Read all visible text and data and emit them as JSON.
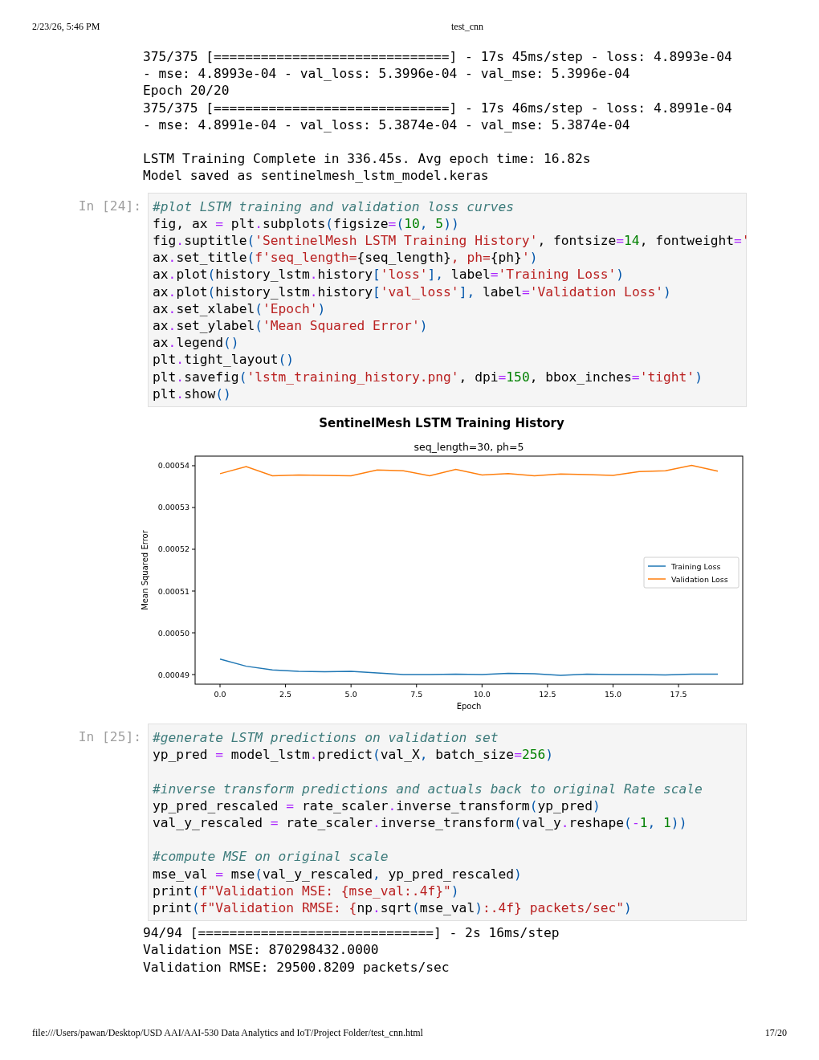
{
  "header": {
    "datetime": "2/23/26, 5:46 PM",
    "title": "test_cnn"
  },
  "cells": [
    {
      "kind": "output",
      "blocks": [
        [
          "375/375 [==============================] - 17s 45ms/step - loss: 4.8993e-04",
          "- mse: 4.8993e-04 - val_loss: 5.3996e-04 - val_mse: 5.3996e-04",
          "Epoch 20/20",
          "375/375 [==============================] - 17s 46ms/step - loss: 4.8991e-04",
          "- mse: 4.8991e-04 - val_loss: 5.3874e-04 - val_mse: 5.3874e-04"
        ],
        [
          "LSTM Training Complete in 336.45s. Avg epoch time: 16.82s",
          "Model saved as sentinelmesh_lstm_model.keras"
        ]
      ]
    },
    {
      "kind": "code",
      "prompt": "In [24]:",
      "blocks": [
        [
          [
            {
              "kind": "comment",
              "text": "#plot LSTM training and validation loss curves"
            }
          ],
          [
            {
              "kind": "text",
              "text": "fig, ax "
            },
            {
              "kind": "operator",
              "text": "="
            },
            {
              "kind": "text",
              "text": " plt"
            },
            {
              "kind": "operator",
              "text": "."
            },
            {
              "kind": "text",
              "text": "subplots"
            },
            {
              "kind": "punct",
              "text": "("
            },
            {
              "kind": "text",
              "text": "figsize"
            },
            {
              "kind": "operator",
              "text": "="
            },
            {
              "kind": "punct",
              "text": "("
            },
            {
              "kind": "number",
              "text": "10"
            },
            {
              "kind": "punct",
              "text": ", "
            },
            {
              "kind": "number",
              "text": "5"
            },
            {
              "kind": "punct",
              "text": "))"
            }
          ],
          [
            {
              "kind": "text",
              "text": "fig"
            },
            {
              "kind": "operator",
              "text": "."
            },
            {
              "kind": "text",
              "text": "suptitle"
            },
            {
              "kind": "punct",
              "text": "("
            },
            {
              "kind": "string",
              "text": "'SentinelMesh LSTM Training History'"
            },
            {
              "kind": "text",
              "text": ", fontsize"
            },
            {
              "kind": "operator",
              "text": "="
            },
            {
              "kind": "number",
              "text": "14"
            },
            {
              "kind": "text",
              "text": ", fontweight"
            },
            {
              "kind": "operator",
              "text": "="
            },
            {
              "kind": "string",
              "text": "'"
            }
          ],
          [
            {
              "kind": "text",
              "text": "ax"
            },
            {
              "kind": "operator",
              "text": "."
            },
            {
              "kind": "text",
              "text": "set_title"
            },
            {
              "kind": "punct",
              "text": "("
            },
            {
              "kind": "string",
              "text": "f'seq_length="
            },
            {
              "kind": "text",
              "text": "{seq_length}"
            },
            {
              "kind": "string",
              "text": ", ph="
            },
            {
              "kind": "text",
              "text": "{ph}"
            },
            {
              "kind": "string",
              "text": "'"
            },
            {
              "kind": "punct",
              "text": ")"
            }
          ],
          [
            {
              "kind": "text",
              "text": "ax"
            },
            {
              "kind": "operator",
              "text": "."
            },
            {
              "kind": "text",
              "text": "plot"
            },
            {
              "kind": "punct",
              "text": "("
            },
            {
              "kind": "text",
              "text": "history_lstm"
            },
            {
              "kind": "operator",
              "text": "."
            },
            {
              "kind": "text",
              "text": "history"
            },
            {
              "kind": "punct",
              "text": "["
            },
            {
              "kind": "string",
              "text": "'loss'"
            },
            {
              "kind": "punct",
              "text": "],"
            },
            {
              "kind": "text",
              "text": " label"
            },
            {
              "kind": "operator",
              "text": "="
            },
            {
              "kind": "string",
              "text": "'Training Loss'"
            },
            {
              "kind": "punct",
              "text": ")"
            }
          ],
          [
            {
              "kind": "text",
              "text": "ax"
            },
            {
              "kind": "operator",
              "text": "."
            },
            {
              "kind": "text",
              "text": "plot"
            },
            {
              "kind": "punct",
              "text": "("
            },
            {
              "kind": "text",
              "text": "history_lstm"
            },
            {
              "kind": "operator",
              "text": "."
            },
            {
              "kind": "text",
              "text": "history"
            },
            {
              "kind": "punct",
              "text": "["
            },
            {
              "kind": "string",
              "text": "'val_loss'"
            },
            {
              "kind": "punct",
              "text": "],"
            },
            {
              "kind": "text",
              "text": " label"
            },
            {
              "kind": "operator",
              "text": "="
            },
            {
              "kind": "string",
              "text": "'Validation Loss'"
            },
            {
              "kind": "punct",
              "text": ")"
            }
          ],
          [
            {
              "kind": "text",
              "text": "ax"
            },
            {
              "kind": "operator",
              "text": "."
            },
            {
              "kind": "text",
              "text": "set_xlabel"
            },
            {
              "kind": "punct",
              "text": "("
            },
            {
              "kind": "string",
              "text": "'Epoch'"
            },
            {
              "kind": "punct",
              "text": ")"
            }
          ],
          [
            {
              "kind": "text",
              "text": "ax"
            },
            {
              "kind": "operator",
              "text": "."
            },
            {
              "kind": "text",
              "text": "set_ylabel"
            },
            {
              "kind": "punct",
              "text": "("
            },
            {
              "kind": "string",
              "text": "'Mean Squared Error'"
            },
            {
              "kind": "punct",
              "text": ")"
            }
          ],
          [
            {
              "kind": "text",
              "text": "ax"
            },
            {
              "kind": "operator",
              "text": "."
            },
            {
              "kind": "text",
              "text": "legend"
            },
            {
              "kind": "punct",
              "text": "()"
            }
          ],
          [
            {
              "kind": "text",
              "text": "plt"
            },
            {
              "kind": "operator",
              "text": "."
            },
            {
              "kind": "text",
              "text": "tight_layout"
            },
            {
              "kind": "punct",
              "text": "()"
            }
          ],
          [
            {
              "kind": "text",
              "text": "plt"
            },
            {
              "kind": "operator",
              "text": "."
            },
            {
              "kind": "text",
              "text": "savefig"
            },
            {
              "kind": "punct",
              "text": "("
            },
            {
              "kind": "string",
              "text": "'lstm_training_history.png'"
            },
            {
              "kind": "text",
              "text": ", dpi"
            },
            {
              "kind": "operator",
              "text": "="
            },
            {
              "kind": "number",
              "text": "150"
            },
            {
              "kind": "text",
              "text": ", bbox_inches"
            },
            {
              "kind": "operator",
              "text": "="
            },
            {
              "kind": "string",
              "text": "'tight'"
            },
            {
              "kind": "punct",
              "text": ")"
            }
          ],
          [
            {
              "kind": "text",
              "text": "plt"
            },
            {
              "kind": "operator",
              "text": "."
            },
            {
              "kind": "text",
              "text": "show"
            },
            {
              "kind": "punct",
              "text": "()"
            }
          ]
        ]
      ]
    },
    {
      "kind": "figure",
      "suptitle": "SentinelMesh LSTM Training History",
      "chart_data": {
        "type": "line",
        "title": "seq_length=30, ph=5",
        "xlabel": "Epoch",
        "ylabel": "Mean Squared Error",
        "x": [
          0,
          1,
          2,
          3,
          4,
          5,
          6,
          7,
          8,
          9,
          10,
          11,
          12,
          13,
          14,
          15,
          16,
          17,
          18,
          19
        ],
        "series": [
          {
            "name": "Training Loss",
            "color": "#1f77b4",
            "values": [
              0.0004937,
              0.000492,
              0.0004911,
              0.0004908,
              0.0004907,
              0.0004908,
              0.0004904,
              0.00049,
              0.00049,
              0.0004901,
              0.00049,
              0.0004903,
              0.0004902,
              0.0004898,
              0.0004901,
              0.00049,
              0.00049,
              0.0004899,
              0.0004901,
              0.0004901
            ]
          },
          {
            "name": "Validation Loss",
            "color": "#ff7f0e",
            "values": [
              0.0005381,
              0.0005398,
              0.0005376,
              0.0005378,
              0.0005377,
              0.0005376,
              0.000539,
              0.0005388,
              0.0005376,
              0.0005391,
              0.0005378,
              0.0005381,
              0.0005376,
              0.000538,
              0.0005379,
              0.0005377,
              0.0005386,
              0.0005388,
              0.0005401,
              0.0005387
            ]
          }
        ],
        "legend": true,
        "xlim": [
          -0.95,
          19.95
        ],
        "ylim": [
          0.0004877,
          0.0005423
        ],
        "xticks": [
          {
            "value": 0,
            "label": "0.0"
          },
          {
            "value": 2.5,
            "label": "2.5"
          },
          {
            "value": 5,
            "label": "5.0"
          },
          {
            "value": 7.5,
            "label": "7.5"
          },
          {
            "value": 10,
            "label": "10.0"
          },
          {
            "value": 12.5,
            "label": "12.5"
          },
          {
            "value": 15,
            "label": "15.0"
          },
          {
            "value": 17.5,
            "label": "17.5"
          }
        ],
        "yticks": [
          {
            "value": 0.00049,
            "label": "0.00049"
          },
          {
            "value": 0.0005,
            "label": "0.00050"
          },
          {
            "value": 0.00051,
            "label": "0.00051"
          },
          {
            "value": 0.00052,
            "label": "0.00052"
          },
          {
            "value": 0.00053,
            "label": "0.00053"
          },
          {
            "value": 0.00054,
            "label": "0.00054"
          }
        ]
      }
    },
    {
      "kind": "code",
      "prompt": "In [25]:",
      "blocks": [
        [
          [
            {
              "kind": "comment",
              "text": "#generate LSTM predictions on validation set"
            }
          ],
          [
            {
              "kind": "text",
              "text": "yp_pred "
            },
            {
              "kind": "operator",
              "text": "="
            },
            {
              "kind": "text",
              "text": " model_lstm"
            },
            {
              "kind": "operator",
              "text": "."
            },
            {
              "kind": "text",
              "text": "predict"
            },
            {
              "kind": "punct",
              "text": "("
            },
            {
              "kind": "text",
              "text": "val_X"
            },
            {
              "kind": "punct",
              "text": ","
            },
            {
              "kind": "text",
              "text": " batch_size"
            },
            {
              "kind": "operator",
              "text": "="
            },
            {
              "kind": "number",
              "text": "256"
            },
            {
              "kind": "punct",
              "text": ")"
            }
          ]
        ],
        [
          [
            {
              "kind": "comment",
              "text": "#inverse transform predictions and actuals back to original Rate scale"
            }
          ],
          [
            {
              "kind": "text",
              "text": "yp_pred_rescaled "
            },
            {
              "kind": "operator",
              "text": "="
            },
            {
              "kind": "text",
              "text": " rate_scaler"
            },
            {
              "kind": "operator",
              "text": "."
            },
            {
              "kind": "text",
              "text": "inverse_transform"
            },
            {
              "kind": "punct",
              "text": "("
            },
            {
              "kind": "text",
              "text": "yp_pred"
            },
            {
              "kind": "punct",
              "text": ")"
            }
          ],
          [
            {
              "kind": "text",
              "text": "val_y_rescaled "
            },
            {
              "kind": "operator",
              "text": "="
            },
            {
              "kind": "text",
              "text": " rate_scaler"
            },
            {
              "kind": "operator",
              "text": "."
            },
            {
              "kind": "text",
              "text": "inverse_transform"
            },
            {
              "kind": "punct",
              "text": "("
            },
            {
              "kind": "text",
              "text": "val_y"
            },
            {
              "kind": "operator",
              "text": "."
            },
            {
              "kind": "text",
              "text": "reshape"
            },
            {
              "kind": "punct",
              "text": "("
            },
            {
              "kind": "operator",
              "text": "-"
            },
            {
              "kind": "number",
              "text": "1"
            },
            {
              "kind": "punct",
              "text": ", "
            },
            {
              "kind": "number",
              "text": "1"
            },
            {
              "kind": "punct",
              "text": "))"
            }
          ]
        ],
        [
          [
            {
              "kind": "comment",
              "text": "#compute MSE on original scale"
            }
          ],
          [
            {
              "kind": "text",
              "text": "mse_val "
            },
            {
              "kind": "operator",
              "text": "="
            },
            {
              "kind": "text",
              "text": " mse"
            },
            {
              "kind": "punct",
              "text": "("
            },
            {
              "kind": "text",
              "text": "val_y_rescaled"
            },
            {
              "kind": "punct",
              "text": ","
            },
            {
              "kind": "text",
              "text": " yp_pred_rescaled"
            },
            {
              "kind": "punct",
              "text": ")"
            }
          ],
          [
            {
              "kind": "text",
              "text": "print"
            },
            {
              "kind": "punct",
              "text": "("
            },
            {
              "kind": "string",
              "text": "f\"Validation MSE: {mse_val:.4f}\""
            },
            {
              "kind": "punct",
              "text": ")"
            }
          ],
          [
            {
              "kind": "text",
              "text": "print"
            },
            {
              "kind": "punct",
              "text": "("
            },
            {
              "kind": "string",
              "text": "f\"Validation RMSE: {"
            },
            {
              "kind": "text",
              "text": "np"
            },
            {
              "kind": "operator",
              "text": "."
            },
            {
              "kind": "text",
              "text": "sqrt"
            },
            {
              "kind": "punct",
              "text": "("
            },
            {
              "kind": "text",
              "text": "mse_val"
            },
            {
              "kind": "punct",
              "text": ")"
            },
            {
              "kind": "string",
              "text": ":.4f} packets/sec\""
            },
            {
              "kind": "punct",
              "text": ")"
            }
          ]
        ]
      ]
    },
    {
      "kind": "output",
      "blocks": [
        [
          "94/94 [==============================] - 2s 16ms/step",
          "Validation MSE: 870298432.0000",
          "Validation RMSE: 29500.8209 packets/sec"
        ]
      ]
    }
  ],
  "footer": {
    "path": "file:///Users/pawan/Desktop/USD AAI/AAI-530 Data Analytics and IoT/Project Folder/test_cnn.html",
    "page": "17/20"
  }
}
